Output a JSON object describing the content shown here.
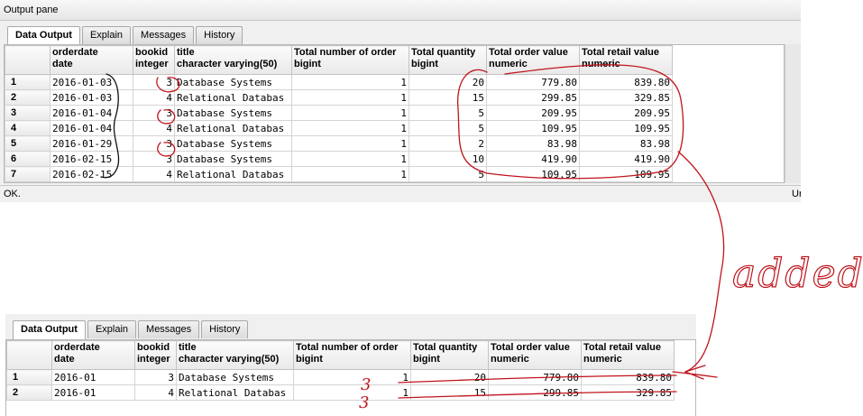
{
  "pane_title": "Output pane",
  "tabs": [
    "Data Output",
    "Explain",
    "Messages",
    "History"
  ],
  "columns": [
    {
      "name": "orderdate",
      "type": "date"
    },
    {
      "name": "bookid",
      "type": "integer"
    },
    {
      "name": "title",
      "type": "character varying(50)"
    },
    {
      "name": "Total number of order",
      "type": "bigint"
    },
    {
      "name": "Total quantity",
      "type": "bigint"
    },
    {
      "name": "Total order value",
      "type": "numeric"
    },
    {
      "name": "Total retail value",
      "type": "numeric"
    }
  ],
  "top_rows": [
    {
      "n": "1",
      "orderdate": "2016-01-03",
      "bookid": "3",
      "title": "Database Systems",
      "num_orders": "1",
      "qty": "20",
      "order_value": "779.80",
      "retail_value": "839.80"
    },
    {
      "n": "2",
      "orderdate": "2016-01-03",
      "bookid": "4",
      "title": "Relational Databas",
      "num_orders": "1",
      "qty": "15",
      "order_value": "299.85",
      "retail_value": "329.85"
    },
    {
      "n": "3",
      "orderdate": "2016-01-04",
      "bookid": "3",
      "title": "Database Systems",
      "num_orders": "1",
      "qty": "5",
      "order_value": "209.95",
      "retail_value": "209.95"
    },
    {
      "n": "4",
      "orderdate": "2016-01-04",
      "bookid": "4",
      "title": "Relational Databas",
      "num_orders": "1",
      "qty": "5",
      "order_value": "109.95",
      "retail_value": "109.95"
    },
    {
      "n": "5",
      "orderdate": "2016-01-29",
      "bookid": "3",
      "title": "Database Systems",
      "num_orders": "1",
      "qty": "2",
      "order_value": "83.98",
      "retail_value": "83.98"
    },
    {
      "n": "6",
      "orderdate": "2016-02-15",
      "bookid": "3",
      "title": "Database Systems",
      "num_orders": "1",
      "qty": "10",
      "order_value": "419.90",
      "retail_value": "419.90"
    },
    {
      "n": "7",
      "orderdate": "2016-02-15",
      "bookid": "4",
      "title": "Relational Databas",
      "num_orders": "1",
      "qty": "5",
      "order_value": "109.95",
      "retail_value": "109.95"
    }
  ],
  "status_text": "OK.",
  "status_right": "Ur",
  "bottom_rows": [
    {
      "n": "1",
      "orderdate": "2016-01",
      "bookid": "3",
      "title": "Database Systems",
      "num_orders": "1",
      "qty": "20",
      "order_value": "779.80",
      "retail_value": "839.80"
    },
    {
      "n": "2",
      "orderdate": "2016-01",
      "bookid": "4",
      "title": "Relational Databas",
      "num_orders": "1",
      "qty": "15",
      "order_value": "299.85",
      "retail_value": "329.85"
    }
  ],
  "annotation_text": "added",
  "annotation_numbers": [
    "3",
    "3"
  ],
  "annotation_color": "#c0141c"
}
